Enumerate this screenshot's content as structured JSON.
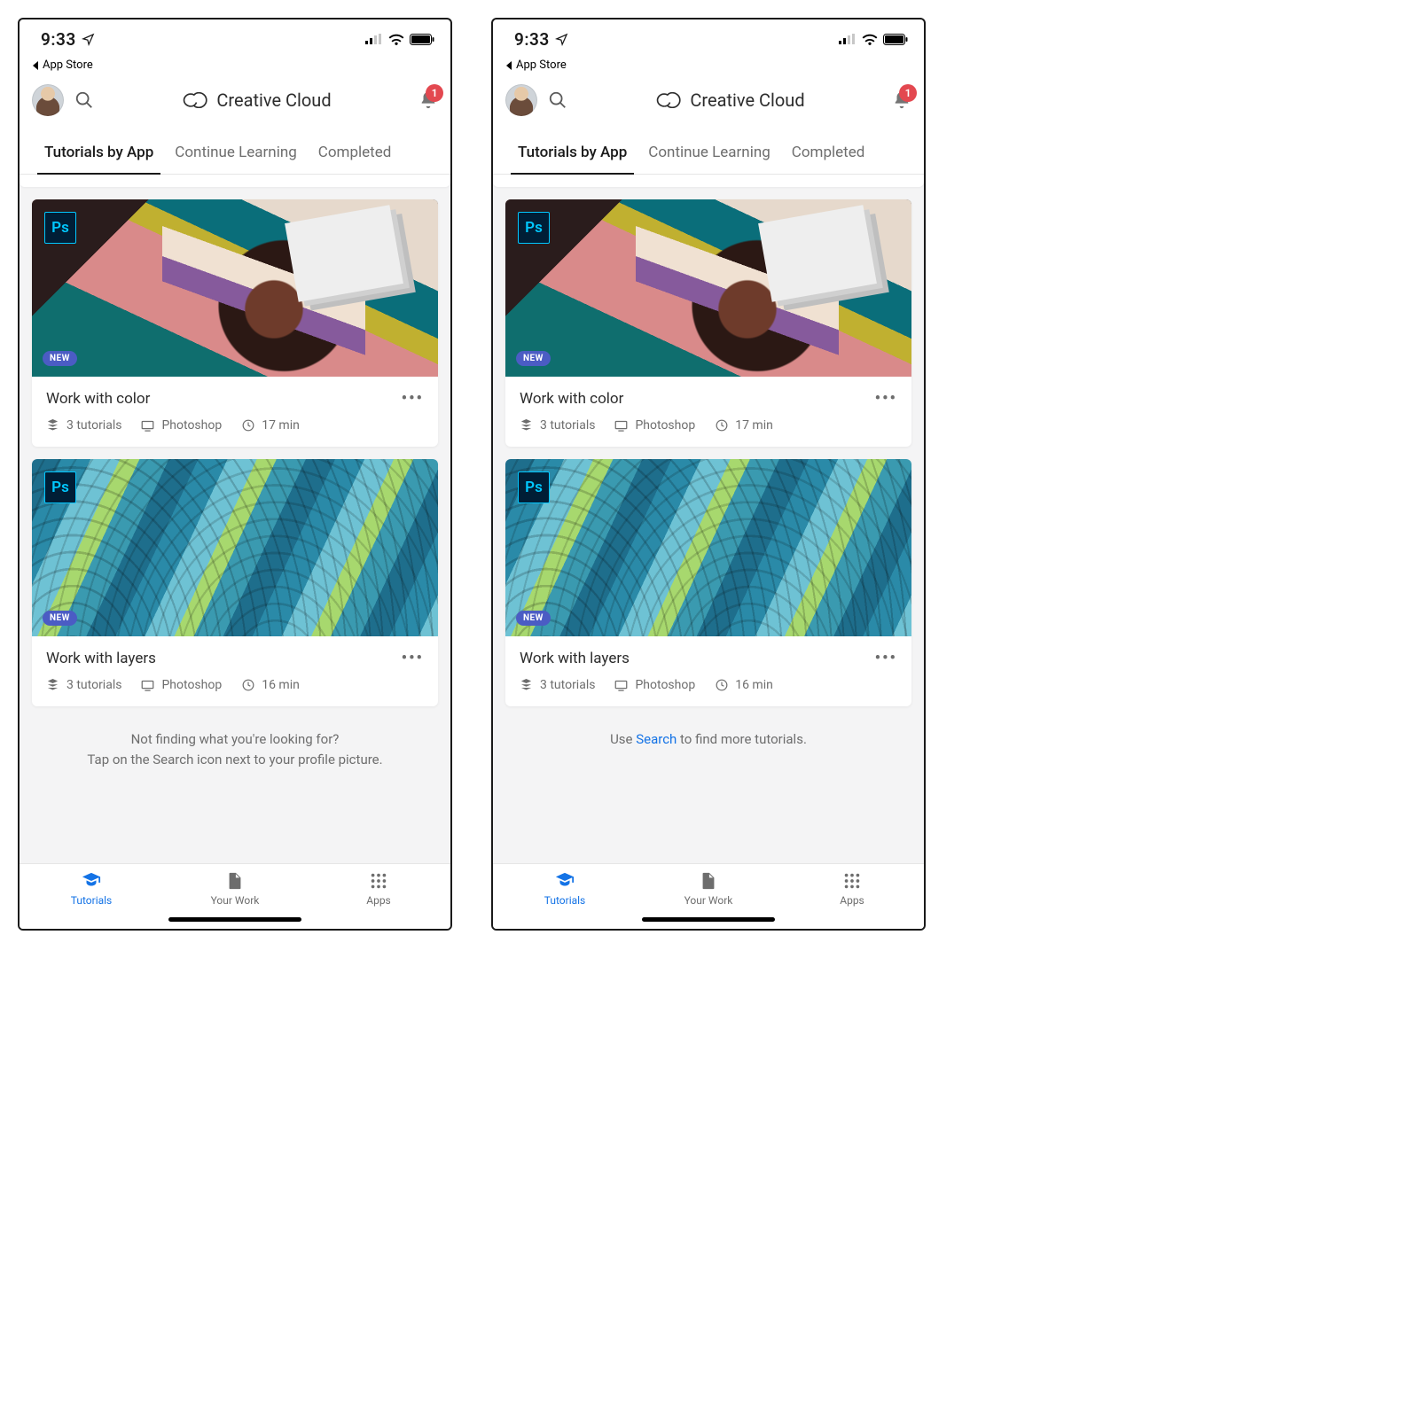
{
  "status": {
    "time": "9:33",
    "back_label": "App Store"
  },
  "header": {
    "title": "Creative Cloud",
    "notification_count": "1"
  },
  "tabs": [
    {
      "label": "Tutorials by App",
      "active": true
    },
    {
      "label": "Continue Learning",
      "active": false
    },
    {
      "label": "Completed",
      "active": false
    }
  ],
  "cards": [
    {
      "app_badge": "Ps",
      "tag": "NEW",
      "title": "Work with color",
      "tutorials": "3 tutorials",
      "app": "Photoshop",
      "duration": "17 min"
    },
    {
      "app_badge": "Ps",
      "tag": "NEW",
      "title": "Work with layers",
      "tutorials": "3 tutorials",
      "app": "Photoshop",
      "duration": "16 min"
    }
  ],
  "footer_variants": {
    "left": {
      "line1": "Not finding what you're looking for?",
      "line2": "Tap on the Search icon next to your profile picture."
    },
    "right": {
      "prefix": "Use ",
      "link": "Search",
      "suffix": " to find more tutorials."
    }
  },
  "bottom_nav": [
    {
      "label": "Tutorials",
      "active": true
    },
    {
      "label": "Your Work",
      "active": false
    },
    {
      "label": "Apps",
      "active": false
    }
  ]
}
